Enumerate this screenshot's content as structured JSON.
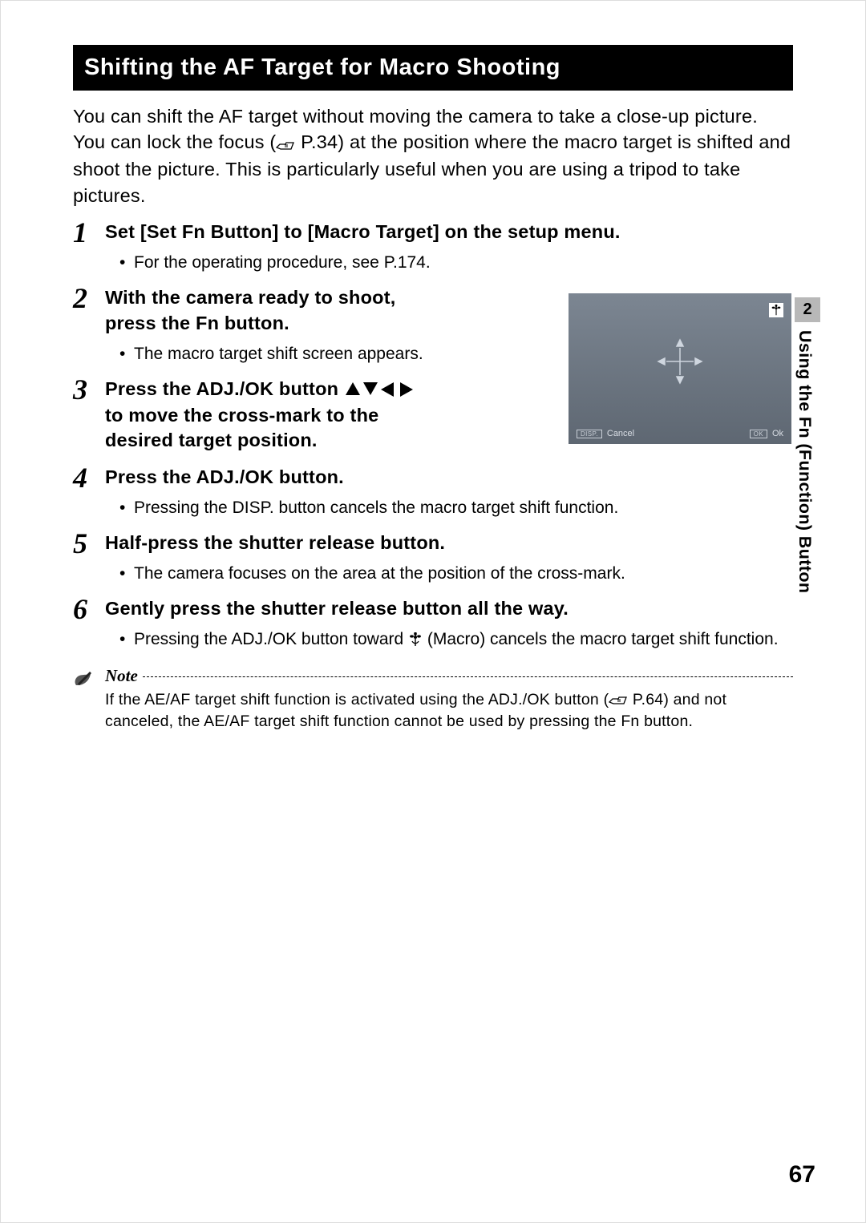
{
  "title": "Shifting the AF Target for Macro Shooting",
  "intro_pre": "You can shift the AF target without moving the camera to take a close-up picture. You can lock the focus (",
  "intro_ref": " P.34",
  "intro_post": ") at the position where the macro target is shifted and shoot the picture. This is particularly useful when you are using a tripod to take pictures.",
  "steps": {
    "s1_title": "Set [Set Fn Button] to [Macro Target] on the setup menu.",
    "s1_b1": "For the operating procedure, see P.174.",
    "s2_title": "With the camera ready to shoot, press the Fn button.",
    "s2_b1": "The macro target shift screen appears.",
    "s3_title_pre": "Press the ADJ./OK button ",
    "s3_title_post": " to move the cross-mark to the desired target position.",
    "s4_title": "Press the ADJ./OK button.",
    "s4_b1": "Pressing the DISP. button cancels the macro target shift function.",
    "s5_title": "Half-press the shutter release button.",
    "s5_b1": "The camera focuses on the area at the position of the cross-mark.",
    "s6_title": "Gently press the shutter release button all the way.",
    "s6_b1_pre": "Pressing the ADJ./OK button toward ",
    "s6_b1_post": " (Macro) cancels the macro target shift function."
  },
  "screenshot": {
    "disp_key": "DISP.",
    "cancel": "Cancel",
    "ok_key": "OK",
    "ok": "Ok"
  },
  "sidebar": {
    "num": "2",
    "label": "Using the Fn (Function) Button"
  },
  "note": {
    "label": "Note",
    "text_pre": "If the AE/AF target shift function is activated using the ADJ./OK button (",
    "text_ref": " P.64",
    "text_post": ") and not canceled, the AE/AF target shift function cannot be used by pressing the Fn button."
  },
  "page_number": "67"
}
